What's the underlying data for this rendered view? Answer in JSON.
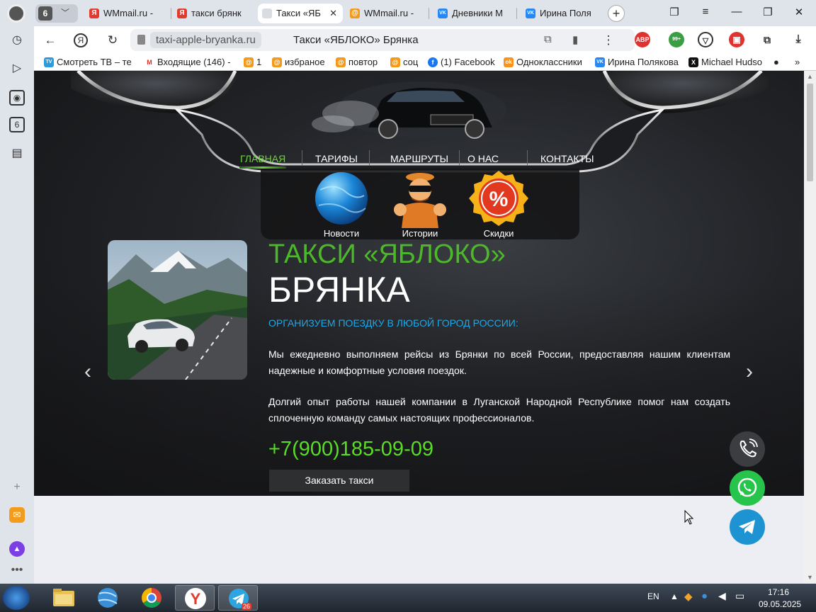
{
  "browser": {
    "tab_count": "6",
    "tabs": [
      {
        "label": "WMmail.ru - ",
        "icon": "Я",
        "color": "#e23a2f"
      },
      {
        "label": "такси брянк",
        "icon": "Я",
        "color": "#e23a2f"
      },
      {
        "label": "Такси «ЯБ",
        "icon": "",
        "color": "#9aa"
      },
      {
        "label": "WMmail.ru - ",
        "icon": "@",
        "color": "#f29a1c"
      },
      {
        "label": "Дневники М",
        "icon": "VK",
        "color": "#2787f5"
      },
      {
        "label": "Ирина Поля",
        "icon": "VK",
        "color": "#2787f5"
      }
    ],
    "url_domain": "taxi-apple-bryanka.ru",
    "page_title": "Такси «ЯБЛОКО» Брянка",
    "ext_abp": "ABP",
    "ext_badge": "99+",
    "sidebar_badge": "6"
  },
  "bookmarks": [
    {
      "label": "Смотреть ТВ – те",
      "icon": "TV",
      "color": "#2b9be0"
    },
    {
      "label": "Входящие (146) -",
      "icon": "M",
      "color": "#d93025"
    },
    {
      "label": "1",
      "icon": "@",
      "color": "#f29a1c"
    },
    {
      "label": "избраное",
      "icon": "@",
      "color": "#f29a1c"
    },
    {
      "label": "повтор",
      "icon": "@",
      "color": "#f29a1c"
    },
    {
      "label": "соц",
      "icon": "@",
      "color": "#f29a1c"
    },
    {
      "label": "(1) Facebook",
      "icon": "f",
      "color": "#1877f2"
    },
    {
      "label": "Одноклассники",
      "icon": "ok",
      "color": "#f7931e"
    },
    {
      "label": "Ирина Полякова",
      "icon": "VK",
      "color": "#2787f5"
    },
    {
      "label": "Michael Hudso",
      "icon": "X",
      "color": "#111111"
    }
  ],
  "site": {
    "menu": [
      "ГЛАВНАЯ",
      "ТАРИФЫ",
      "МАРШРУТЫ",
      "О НАС",
      "КОНТАКТЫ"
    ],
    "submenu": [
      "Новости",
      "Истории",
      "Скидки"
    ],
    "hero_title": "ТАКСИ «ЯБЛОКО»",
    "hero_city": "БРЯНКА",
    "hero_subtitle": "ОРГАНИЗУЕМ ПОЕЗДКУ В ЛЮБОЙ ГОРОД РОССИИ:",
    "paragraph1": "Мы ежедневно выполняем рейсы из Брянки по всей России, предоставляя нашим клиентам надежные и комфортные условия поездок.",
    "paragraph2": "Долгий опыт работы нашей компании в Луганской Народной Республике помог нам создать сплоченную команду самых настоящих профессионалов.",
    "phone": "+7(900)185-09-09",
    "order_button": "Заказать такси"
  },
  "taskbar": {
    "lang": "EN",
    "time": "17:16",
    "date": "09.05.2025",
    "telegram_badge": "26"
  },
  "colors": {
    "accent_green": "#4cb82a",
    "phone_green": "#59dc26",
    "subtitle_blue": "#1ea8e8",
    "whatsapp": "#27c44b",
    "telegram": "#1d93d2"
  }
}
